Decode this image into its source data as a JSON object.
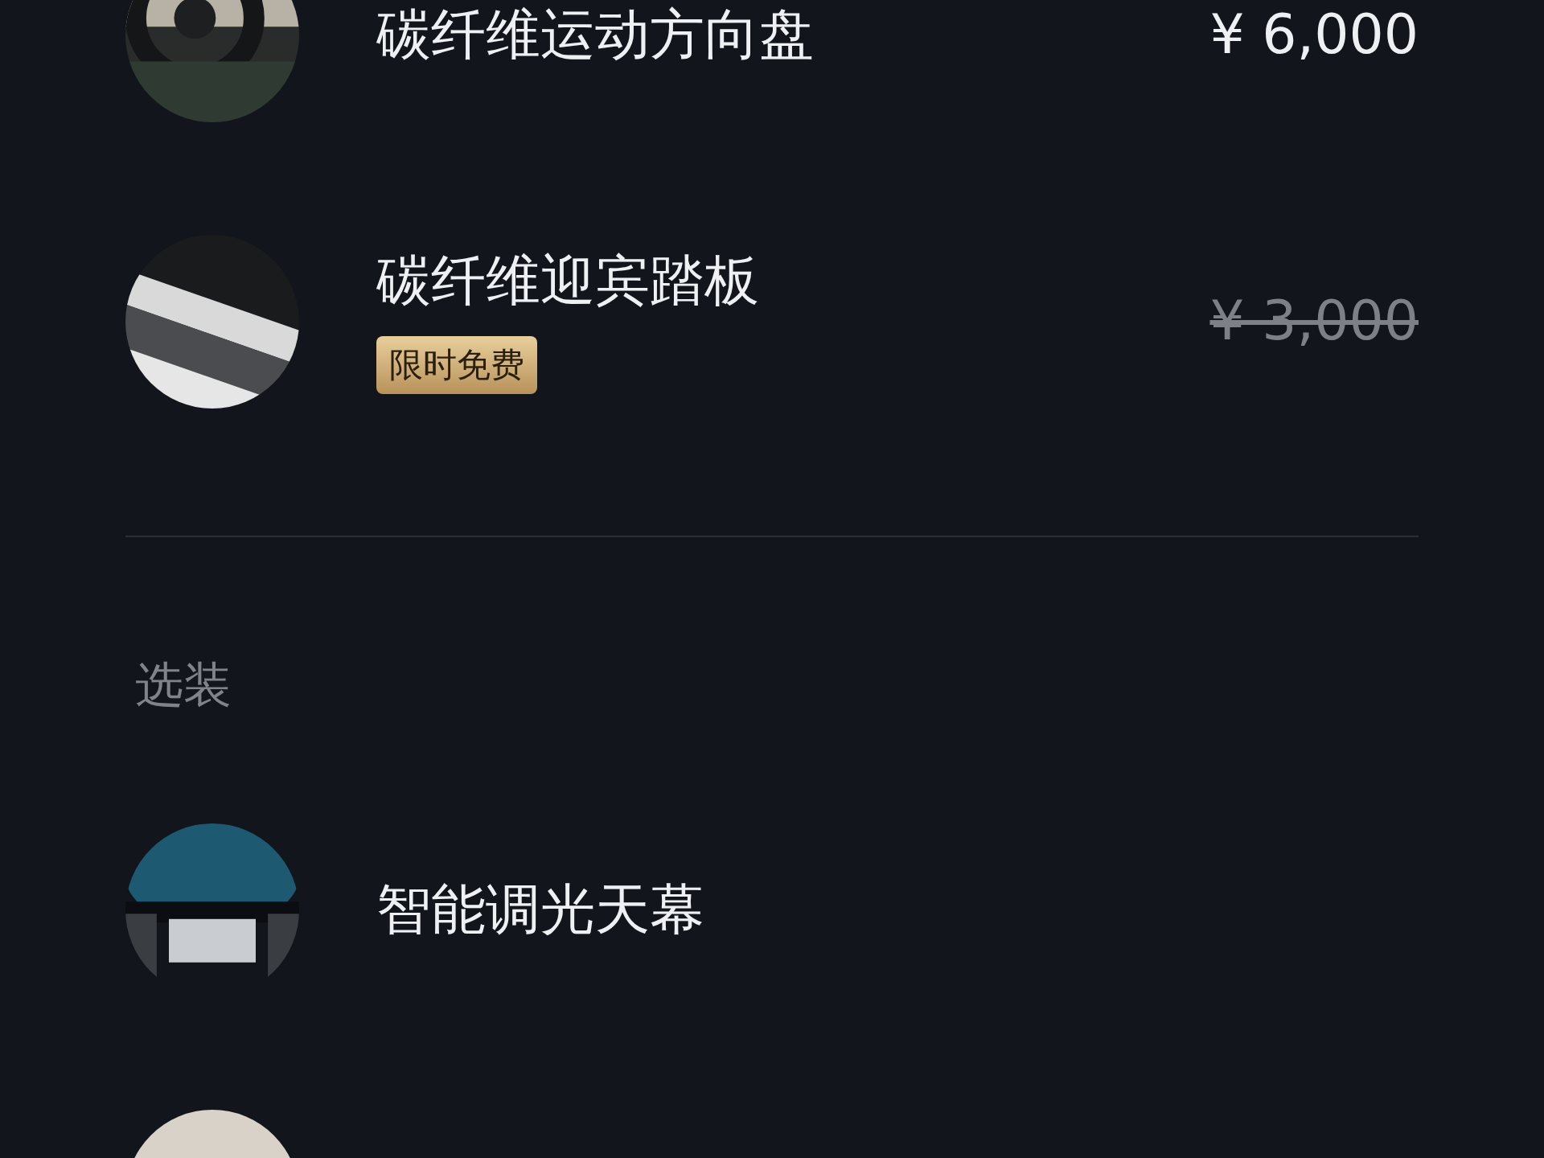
{
  "included": [
    {
      "kind": "picture",
      "title": "碳纤维运动方向盘",
      "price": "¥ 6,000",
      "struck": false
    },
    {
      "kind": "picture",
      "title": "碳纤维迎宾踏板",
      "badge": "限时免费",
      "price": "¥ 3,000",
      "struck": true
    }
  ],
  "optional": {
    "heading": "选装",
    "items": [
      {
        "kind": "picture",
        "title": "智能调光天幕"
      },
      {
        "kind": "picture"
      }
    ]
  }
}
